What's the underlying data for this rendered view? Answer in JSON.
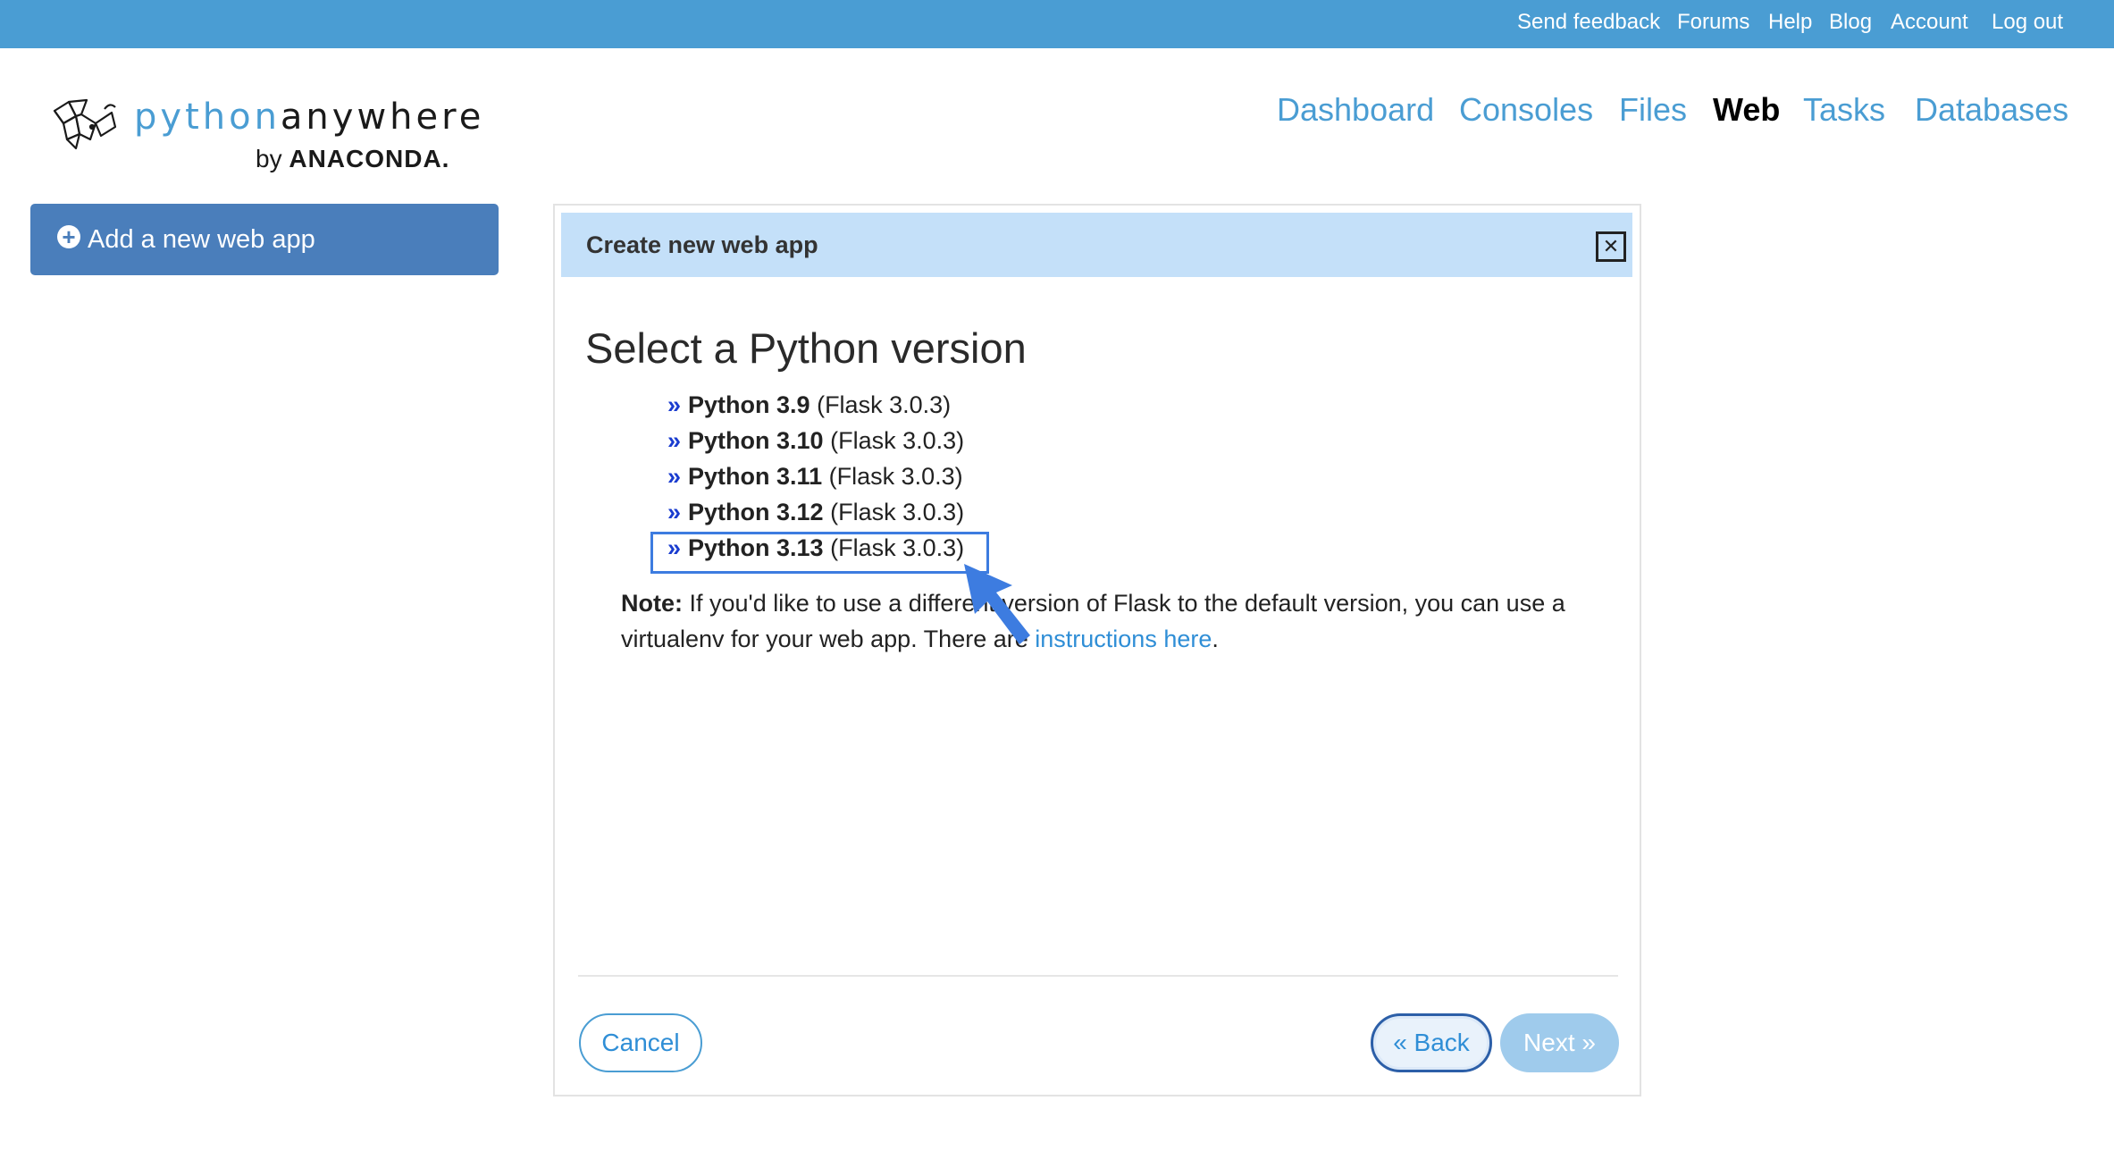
{
  "topbar": {
    "links": [
      "Send feedback",
      "Forums",
      "Help",
      "Blog",
      "Account",
      "Log out"
    ]
  },
  "logo": {
    "word_part1": "python",
    "word_part2": "anywhere",
    "by": "by",
    "company": "ANACONDA."
  },
  "nav": {
    "items": [
      "Dashboard",
      "Consoles",
      "Files",
      "Web",
      "Tasks",
      "Databases"
    ],
    "active": "Web"
  },
  "sidebar": {
    "add_button_label": "Add a new web app"
  },
  "dialog": {
    "title": "Create new web app",
    "close_label": "Close",
    "section_title": "Select a Python version",
    "versions": [
      {
        "name": "Python 3.9",
        "framework": "(Flask 3.0.3)"
      },
      {
        "name": "Python 3.10",
        "framework": "(Flask 3.0.3)"
      },
      {
        "name": "Python 3.11",
        "framework": "(Flask 3.0.3)"
      },
      {
        "name": "Python 3.12",
        "framework": "(Flask 3.0.3)"
      },
      {
        "name": "Python 3.13",
        "framework": "(Flask 3.0.3)"
      }
    ],
    "highlighted_version": "Python 3.13",
    "note_label": "Note:",
    "note_text": "If you'd like to use a different version of Flask to the default version, you can use a virtualenv for your web app. There are",
    "note_link": "instructions here",
    "note_end": ".",
    "buttons": {
      "cancel": "Cancel",
      "back": "« Back",
      "next": "Next »"
    }
  },
  "colors": {
    "topbar": "#4a9dd3",
    "link": "#4a9dd3",
    "add_button": "#4a7ebb",
    "dialog_header": "#c4e0f9",
    "highlight": "#3d7ce0"
  }
}
